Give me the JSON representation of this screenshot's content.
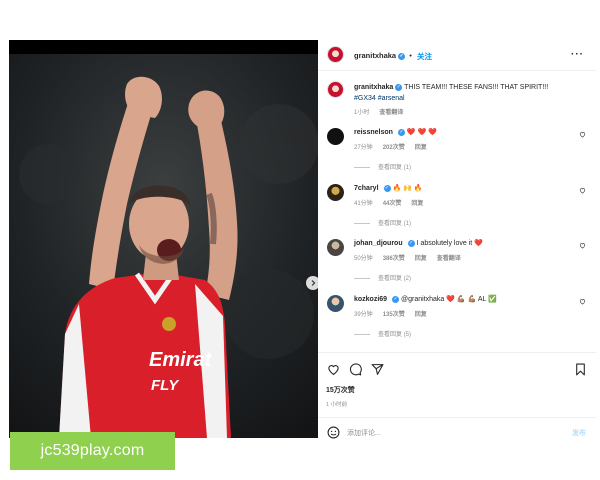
{
  "watermark": {
    "text": "jc539play.com"
  },
  "post": {
    "author": "granitxhaka",
    "follow_label": "关注",
    "caption": {
      "user": "granitxhaka",
      "text": "THIS TEAM!!! THESE FANS!!! THAT SPIRIT!!!",
      "hashtags": "#GX34 #arsenal",
      "time": "1小时",
      "translate": "查看翻译"
    },
    "photo": {
      "jersey_sponsor": "Emirates FLY BETTER",
      "carousel_dots": 3
    },
    "comments": [
      {
        "user": "reissnelson",
        "text": "❤️ ❤️ ❤️",
        "time": "27分钟",
        "likes": "202次赞",
        "reply": "回复",
        "translate": "",
        "view_replies": "查看回复 (1)"
      },
      {
        "user": "7charyl",
        "text": "🔥 🙌 🔥",
        "time": "41分钟",
        "likes": "44次赞",
        "reply": "回复",
        "translate": "",
        "view_replies": "查看回复 (1)"
      },
      {
        "user": "johan_djourou",
        "text": "I absolutely love it ❤️",
        "time": "50分钟",
        "likes": "386次赞",
        "reply": "回复",
        "translate": "查看翻译",
        "view_replies": "查看回复 (2)"
      },
      {
        "user": "kozkozi69",
        "text": "@granitxhaka ❤️ 💪🏽 💪🏽 AL ✅",
        "time": "39分钟",
        "likes": "135次赞",
        "reply": "回复",
        "translate": "",
        "view_replies": "查看回复 (5)"
      }
    ],
    "likes_count": "15万次赞",
    "posted_time": "1 小时前",
    "comment_placeholder": "添加评论...",
    "post_button": "发布",
    "icons": {
      "like": "heart-icon",
      "comment": "comment-icon",
      "share": "share-icon",
      "save": "bookmark-icon",
      "emoji": "emoji-icon",
      "more": "more-icon"
    }
  }
}
